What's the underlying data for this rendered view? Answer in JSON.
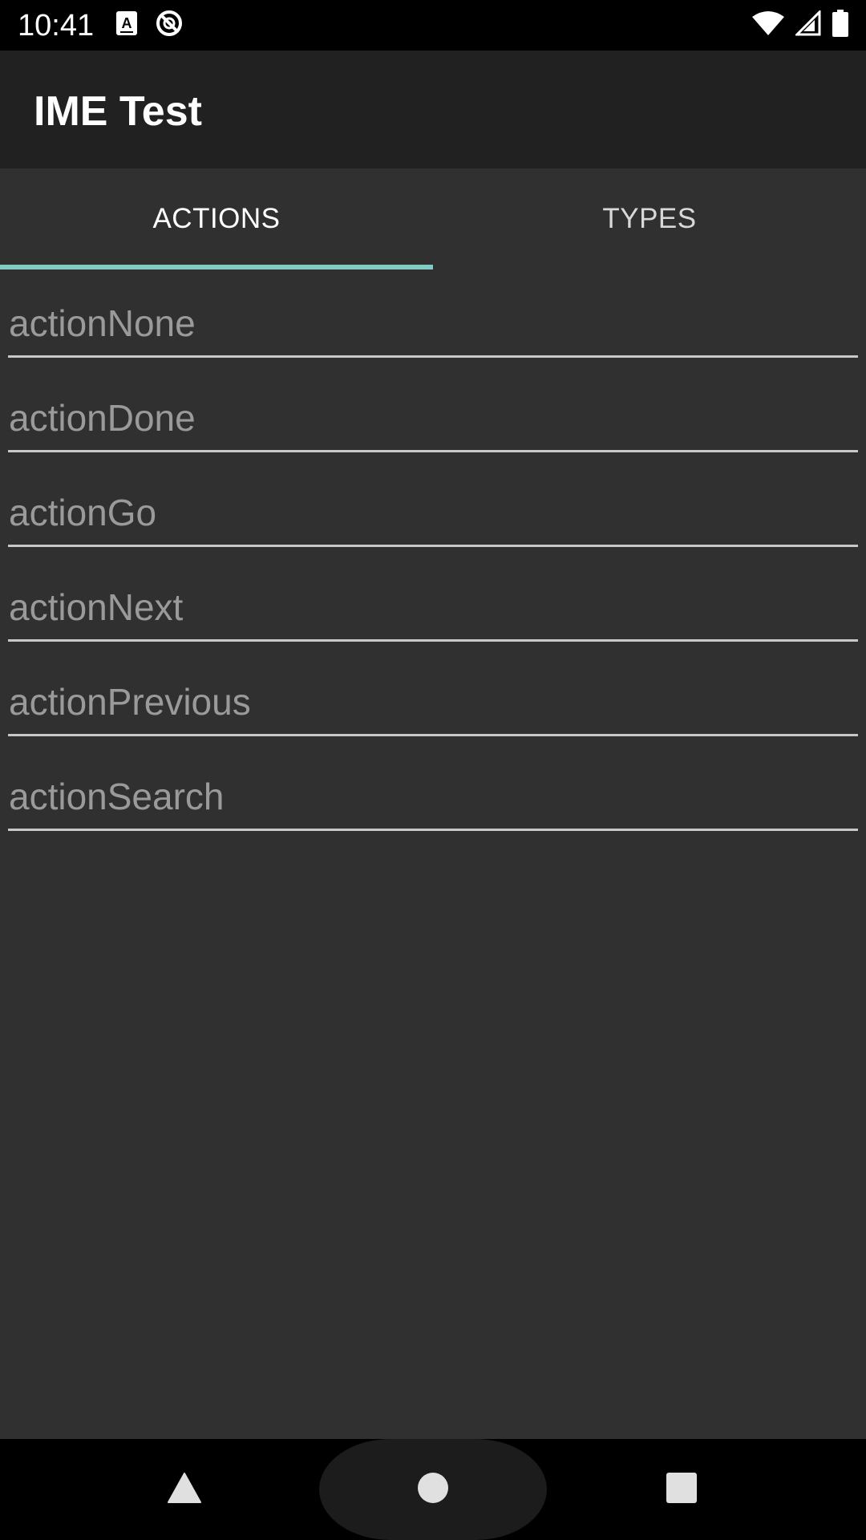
{
  "status_bar": {
    "time": "10:41",
    "left_icons": [
      "keyboard-a-icon",
      "sync-disabled-icon"
    ],
    "right_icons": [
      "wifi-icon",
      "cell-signal-icon",
      "battery-icon"
    ]
  },
  "app_bar": {
    "title": "IME Test"
  },
  "tabs": [
    {
      "label": "ACTIONS",
      "selected": true
    },
    {
      "label": "TYPES",
      "selected": false
    }
  ],
  "fields": [
    {
      "placeholder": "actionNone",
      "value": ""
    },
    {
      "placeholder": "actionDone",
      "value": ""
    },
    {
      "placeholder": "actionGo",
      "value": ""
    },
    {
      "placeholder": "actionNext",
      "value": ""
    },
    {
      "placeholder": "actionPrevious",
      "value": ""
    },
    {
      "placeholder": "actionSearch",
      "value": ""
    }
  ],
  "nav_bar": {
    "icons": [
      "back-icon",
      "home-icon",
      "recents-icon"
    ]
  },
  "colors": {
    "background": "#303030",
    "app_bar": "#212121",
    "tab_indicator": "#80cbc4",
    "placeholder": "#9a9a9a",
    "underline": "#c8c8c8"
  }
}
